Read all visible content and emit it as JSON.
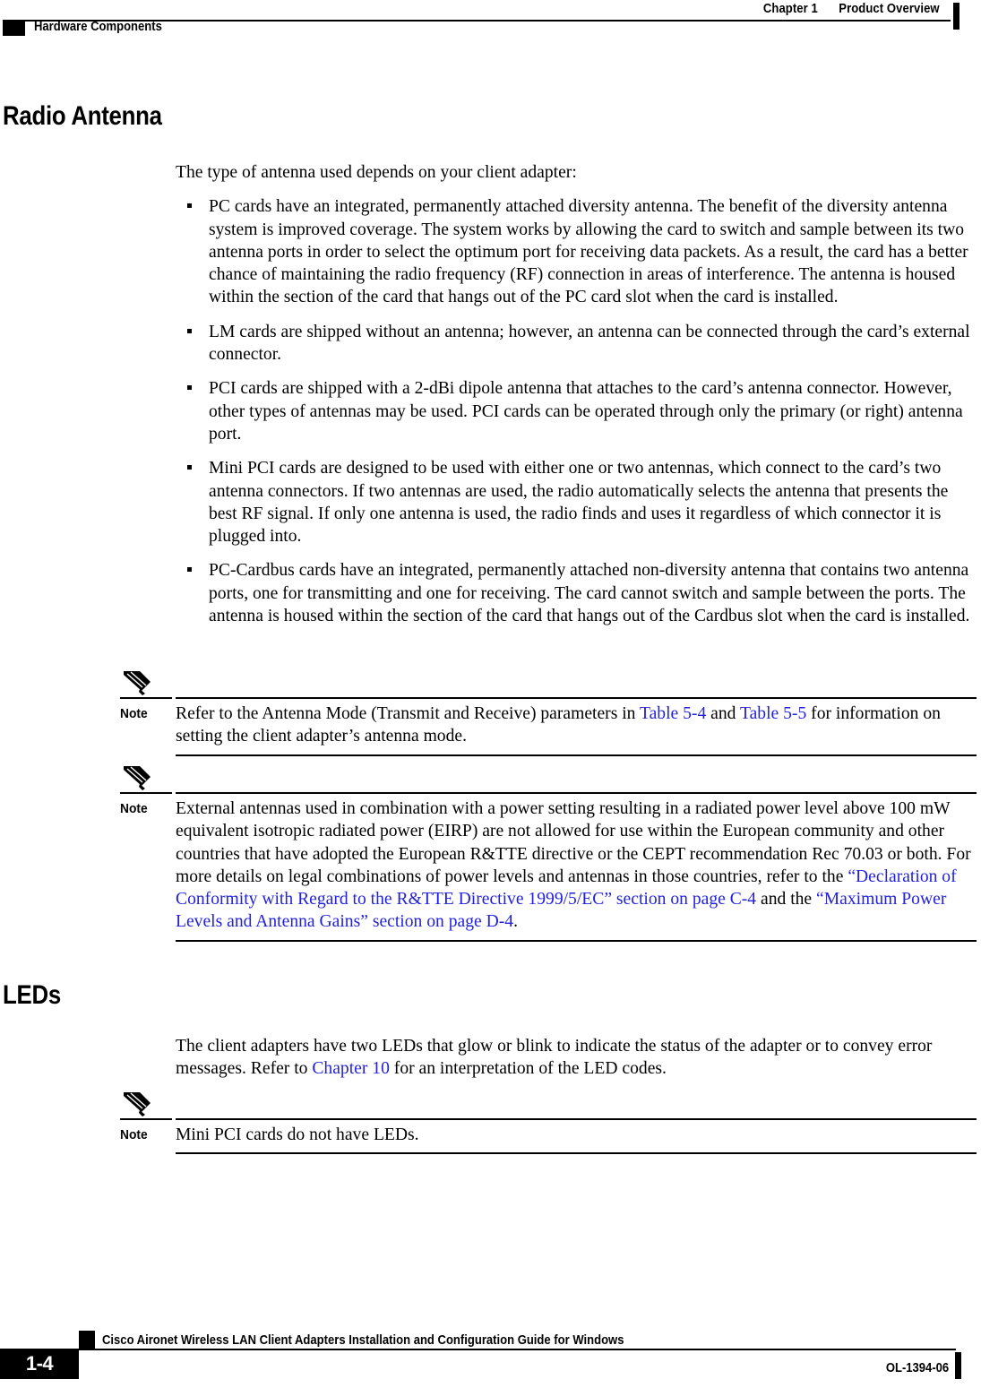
{
  "header": {
    "chapter_number": "Chapter 1",
    "chapter_title": "Product Overview",
    "section_title": "Hardware Components"
  },
  "sections": {
    "radio_antenna": {
      "heading": "Radio Antenna",
      "intro": "The type of antenna used depends on your client adapter:",
      "bullets": [
        "PC cards have an integrated, permanently attached diversity antenna. The benefit of the diversity antenna system is improved coverage. The system works by allowing the card to switch and sample between its two antenna ports in order to select the optimum port for receiving data packets. As a result, the card has a better chance of maintaining the radio frequency (RF) connection in areas of interference. The antenna is housed within the section of the card that hangs out of the PC card slot when the card is installed.",
        "LM cards are shipped without an antenna; however, an antenna can be connected through the card’s external connector.",
        "PCI cards are shipped with a 2-dBi dipole antenna that attaches to the card’s antenna connector. However, other types of antennas may be used. PCI cards can be operated through only the primary (or right) antenna port.",
        "Mini PCI cards are designed to be used with either one or two antennas, which connect to the card’s two antenna connectors. If two antennas are used, the radio automatically selects the antenna that presents the best RF signal. If only one antenna is used, the radio finds and uses it regardless of which connector it is plugged into.",
        "PC-Cardbus cards have an integrated, permanently attached non-diversity antenna that contains two antenna ports, one for transmitting and one for receiving. The card cannot switch and sample between the ports. The antenna is housed within the section of the card that hangs out of the Cardbus slot when the card is installed."
      ]
    },
    "leds": {
      "heading": "LEDs",
      "para_before_link": "The client adapters have two LEDs that glow or blink to indicate the status of the adapter or to convey error messages. Refer to ",
      "link_text": "Chapter 10",
      "para_after_link": " for an interpretation of the LED codes."
    }
  },
  "notes": [
    {
      "label": "Note",
      "icon": "pencil-icon",
      "part1": "Refer to the Antenna Mode (Transmit and Receive) parameters in ",
      "link1": "Table 5-4",
      "part2": " and ",
      "link2": "Table 5-5",
      "part3": " for information on setting the client adapter’s antenna mode."
    },
    {
      "label": "Note",
      "icon": "pencil-icon",
      "part1": "External antennas used in combination with a power setting resulting in a radiated power level above 100 mW equivalent isotropic radiated power (EIRP) are not allowed for use within the European community and other countries that have adopted the European R&TTE directive or the CEPT recommendation Rec 70.03 or both. For more details on legal combinations of power levels and antennas in those countries, refer to the ",
      "link1": "“Declaration of Conformity with Regard to the R&TTE Directive 1999/5/EC” section on page C-4",
      "part2": " and the ",
      "link2": "“Maximum Power Levels and Antenna Gains” section on page D-4",
      "part3": "."
    },
    {
      "label": "Note",
      "icon": "pencil-icon",
      "text": "Mini PCI cards do not have LEDs."
    }
  ],
  "footer": {
    "page_number": "1-4",
    "guide_title": "Cisco Aironet Wireless LAN Client Adapters Installation and Configuration Guide for Windows",
    "doc_number": "OL-1394-06"
  },
  "colors": {
    "link": "#2222dd",
    "text": "#000000",
    "rule": "#000000"
  }
}
